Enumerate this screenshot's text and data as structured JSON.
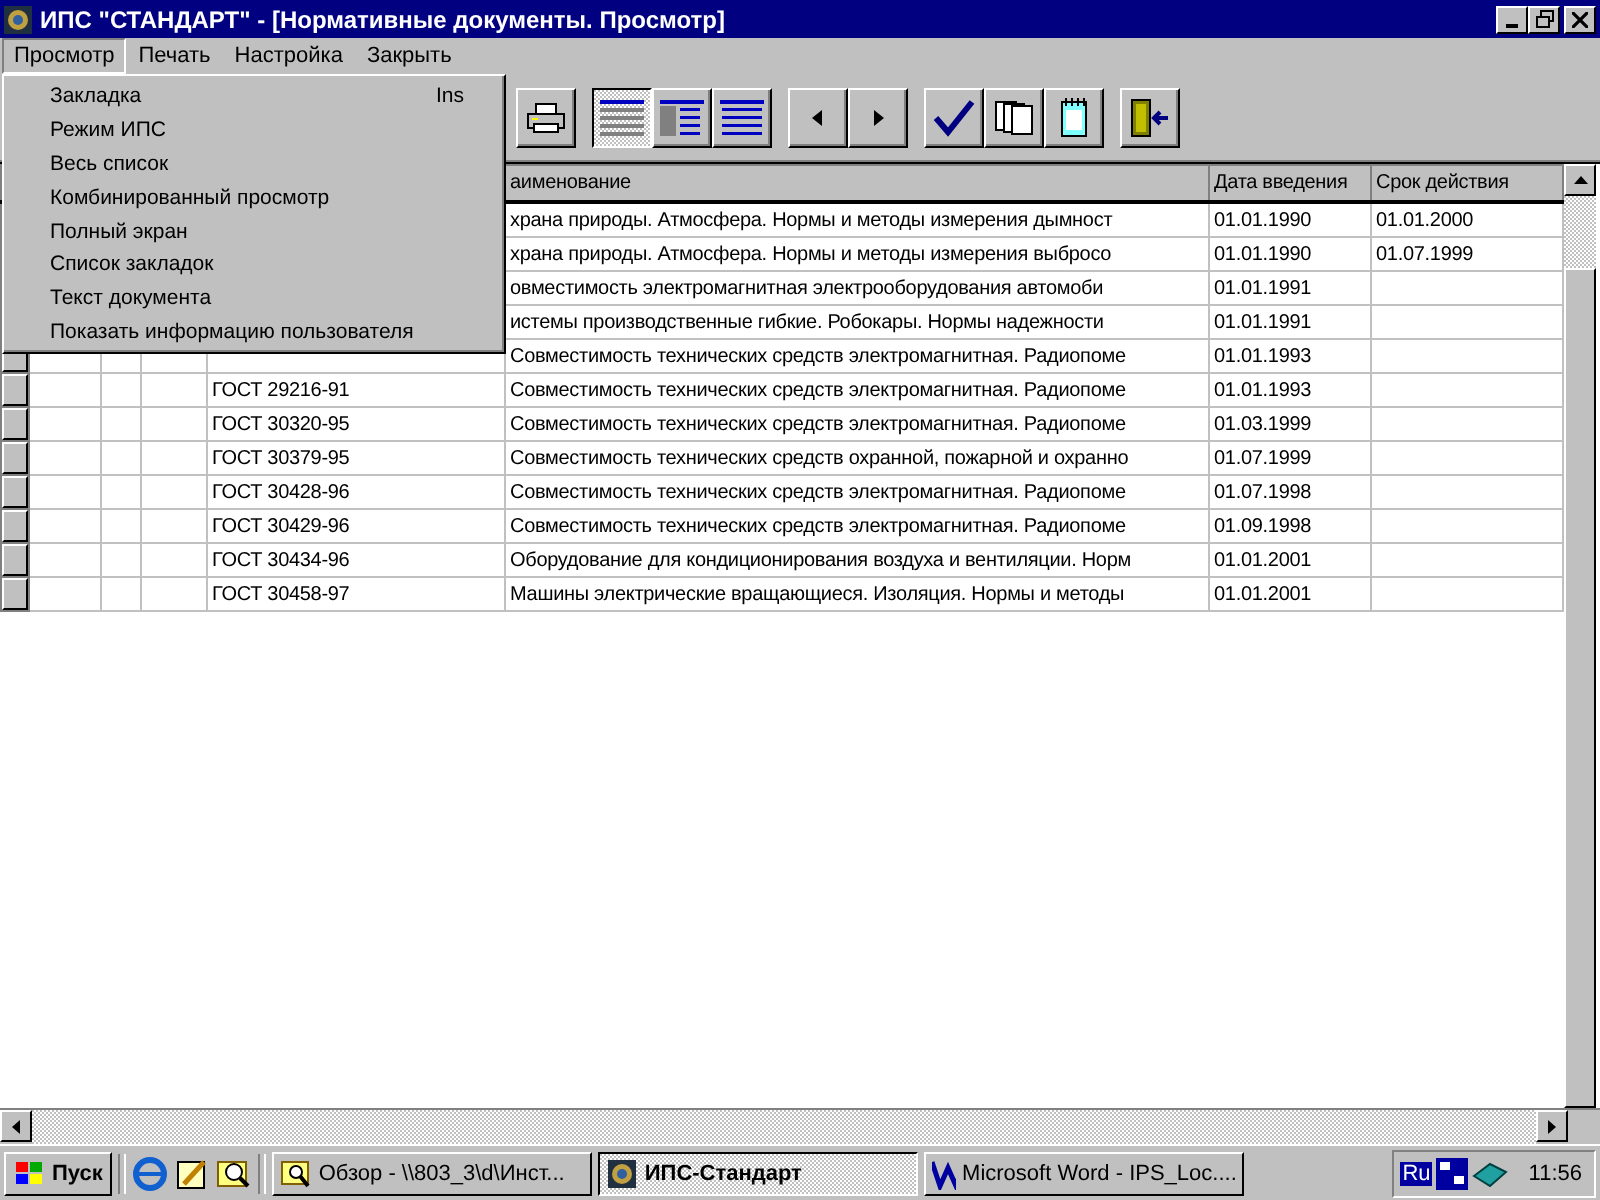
{
  "window": {
    "title": "ИПС \"СТАНДАРТ\" - [Нормативные документы. Просмотр]"
  },
  "menu_bar": [
    {
      "label": "Просмотр",
      "selected": true
    },
    {
      "label": "Печать",
      "selected": false
    },
    {
      "label": "Настройка",
      "selected": false
    },
    {
      "label": "Закрыть",
      "selected": false
    }
  ],
  "dropdown_menu": [
    {
      "label": "Закладка",
      "shortcut": "Ins"
    },
    {
      "label": "Режим ИПС"
    },
    {
      "label": "Весь список"
    },
    {
      "label": "Комбинированный просмотр"
    },
    {
      "label": "Полный экран"
    },
    {
      "label": "Список закладок"
    },
    {
      "label": "Текст документа"
    },
    {
      "label": "Показать информацию пользователя"
    }
  ],
  "view_modes": [
    {
      "selected": true
    },
    {
      "selected": false
    },
    {
      "selected": false
    }
  ],
  "table": {
    "columns": [
      "аименование",
      "Дата введения",
      "Срок действия"
    ],
    "rows": [
      {
        "name": "храна природы. Атмосфера. Нормы и методы измерения дымност",
        "date": "01.01.1990",
        "term": "01.01.2000"
      },
      {
        "name": "храна природы. Атмосфера. Нормы и методы измерения выбросо",
        "date": "01.01.1990",
        "term": "01.07.1999"
      },
      {
        "name": "овместимость электромагнитная электрооборудования автомоби",
        "date": "01.01.1991"
      },
      {
        "name": "истемы производственные гибкие. Робокары. Нормы надежности",
        "date": "01.01.1991"
      },
      {
        "name": "Совместимость технических средств электромагнитная. Радиопоме",
        "date": "01.01.1993"
      },
      {
        "code": "ГОСТ 29216-91",
        "name": "Совместимость технических средств электромагнитная. Радиопоме",
        "date": "01.01.1993"
      },
      {
        "code": "ГОСТ 30320-95",
        "name": "Совместимость технических средств электромагнитная. Радиопоме",
        "date": "01.03.1999"
      },
      {
        "code": "ГОСТ 30379-95",
        "name": "Совместимость технических средств охранной, пожарной и охранно",
        "date": "01.07.1999"
      },
      {
        "code": "ГОСТ 30428-96",
        "name": "Совместимость технических средств электромагнитная. Радиопоме",
        "date": "01.07.1998"
      },
      {
        "code": "ГОСТ 30429-96",
        "name": "Совместимость технических средств электромагнитная. Радиопоме",
        "date": "01.09.1998"
      },
      {
        "code": "ГОСТ 30434-96",
        "name": "Оборудование для кондиционирования воздуха и вентиляции. Норм",
        "date": "01.01.2001"
      },
      {
        "code": "ГОСТ 30458-97",
        "name": "Машины электрические вращающиеся. Изоляция. Нормы и методы",
        "date": "01.01.2001"
      }
    ]
  },
  "taskbar": {
    "start": "Пуск",
    "tasks": [
      {
        "label": "Обзор - \\\\803_3\\d\\Инст...",
        "kind": "explorer",
        "selected": false
      },
      {
        "label": "ИПС-Стандарт",
        "kind": "app",
        "selected": true
      },
      {
        "label": "Microsoft Word - IPS_Loc....",
        "kind": "word",
        "selected": false
      }
    ],
    "language": "Ru",
    "clock": "11:56"
  }
}
